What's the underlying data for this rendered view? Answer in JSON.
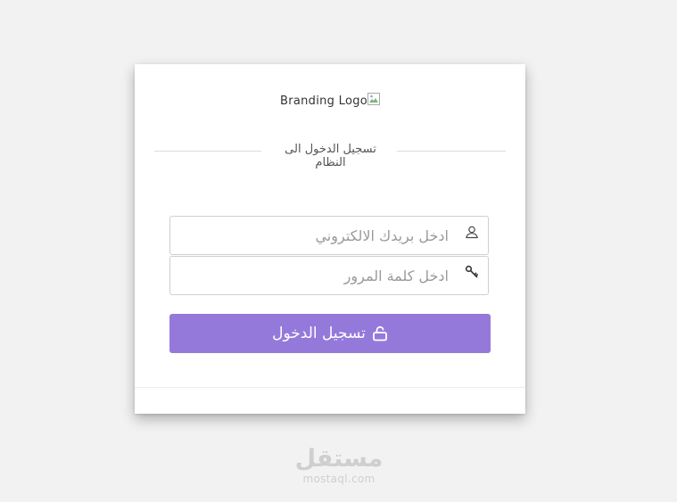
{
  "branding": {
    "logo_text": "Branding Logo"
  },
  "login": {
    "section_title": "تسجيل الدخول الى النظام",
    "email_placeholder": "ادخل بريدك الالكتروني",
    "password_placeholder": "ادخل كلمة المرور",
    "submit_label": "تسجيل الدخول"
  },
  "icons": {
    "email_field": "user-icon",
    "password_field": "key-icon",
    "submit": "unlock-icon",
    "logo": "broken-image-icon"
  },
  "colors": {
    "background": "#f2f2f2",
    "card": "#ffffff",
    "primary_button": "#9579da",
    "input_border": "#cfcfcf",
    "placeholder": "#9a9a9a"
  },
  "watermark": {
    "arabic": "مستقل",
    "latin": "mostaql.com"
  }
}
